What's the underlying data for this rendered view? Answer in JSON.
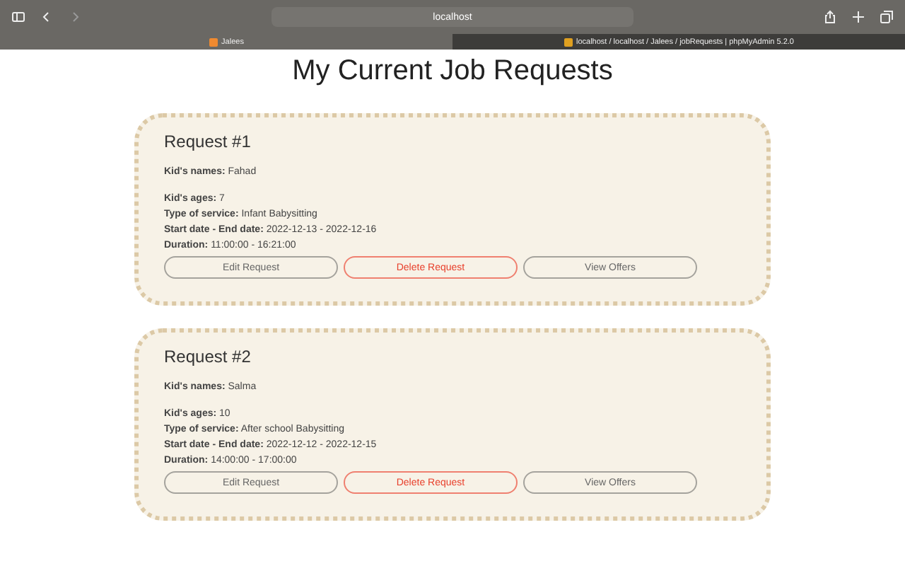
{
  "browser": {
    "address": "localhost",
    "tabs": [
      {
        "title": "Jalees",
        "selected": true
      },
      {
        "title": "localhost / localhost / Jalees / jobRequests | phpMyAdmin 5.2.0",
        "selected": false
      }
    ]
  },
  "heading": "My Current Job Requests",
  "requests": [
    {
      "title": "Request #1",
      "names": {
        "label": "Kid's names:",
        "value": "Fahad"
      },
      "details": [
        {
          "label": "Kid's ages:",
          "value": "7"
        },
        {
          "label": "Type of service:",
          "value": "Infant Babysitting"
        },
        {
          "label": "Start date - End date:",
          "value": "2022-12-13 - 2022-12-16"
        },
        {
          "label": "Duration:",
          "value": "11:00:00 - 16:21:00"
        }
      ],
      "buttons": [
        {
          "label": "Edit Request",
          "kind": "plain"
        },
        {
          "label": "Delete Request",
          "kind": "danger"
        },
        {
          "label": "View Offers",
          "kind": "plain"
        }
      ]
    },
    {
      "title": "Request #2",
      "names": {
        "label": "Kid's names:",
        "value": "Salma"
      },
      "details": [
        {
          "label": "Kid's ages:",
          "value": "10"
        },
        {
          "label": "Type of service:",
          "value": "After school Babysitting"
        },
        {
          "label": "Start date - End date:",
          "value": "2022-12-12 - 2022-12-15"
        },
        {
          "label": "Duration:",
          "value": "14:00:00 - 17:00:00"
        }
      ],
      "buttons": [
        {
          "label": "Edit Request",
          "kind": "plain"
        },
        {
          "label": "Delete Request",
          "kind": "danger"
        },
        {
          "label": "View Offers",
          "kind": "plain"
        }
      ]
    }
  ]
}
